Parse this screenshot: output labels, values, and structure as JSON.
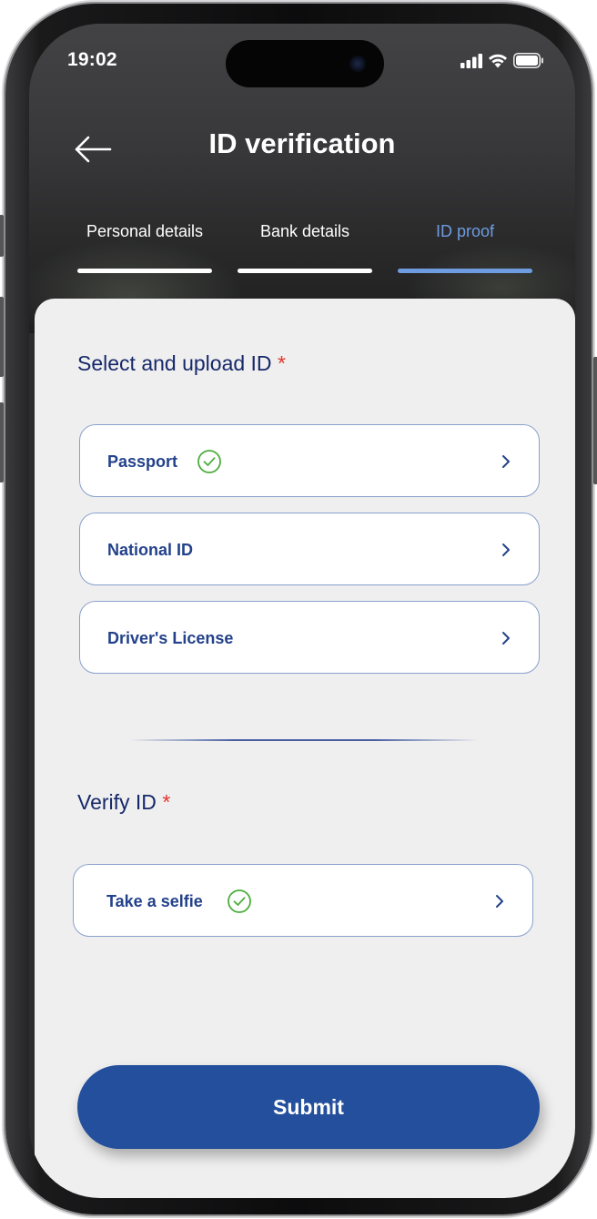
{
  "status_bar": {
    "time": "19:02",
    "icons": [
      "signal-icon",
      "wifi-icon",
      "battery-icon"
    ]
  },
  "header": {
    "title": "ID verification",
    "back_icon": "arrow-left-icon"
  },
  "tabs": [
    {
      "label": "Personal details",
      "active": false
    },
    {
      "label": "Bank details",
      "active": false
    },
    {
      "label": "ID proof",
      "active": true
    }
  ],
  "upload_section": {
    "title": "Select and upload ID",
    "required_mark": "*",
    "options": [
      {
        "label": "Passport",
        "verified": true
      },
      {
        "label": "National ID",
        "verified": false
      },
      {
        "label": "Driver's License",
        "verified": false
      }
    ]
  },
  "verify_section": {
    "title": "Verify ID",
    "required_mark": "*",
    "options": [
      {
        "label": "Take a selfie",
        "verified": true
      }
    ]
  },
  "submit": {
    "label": "Submit"
  },
  "colors": {
    "primary": "#234f9c",
    "active_tab": "#6f9ce0",
    "heading": "#17286a",
    "option_text": "#23428b",
    "required": "#e2352b",
    "check": "#4cae3c",
    "sheet_bg": "#efefef"
  }
}
